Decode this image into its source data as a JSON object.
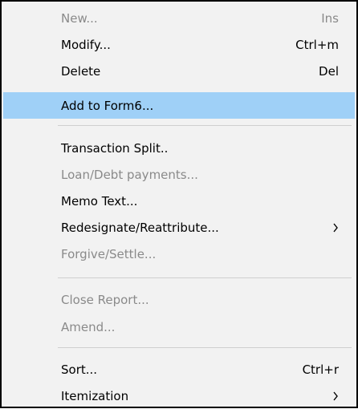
{
  "menu": {
    "items": [
      {
        "label": "New...",
        "shortcut": "Ins",
        "disabled": true
      },
      {
        "label": "Modify...",
        "shortcut": "Ctrl+m",
        "disabled": false
      },
      {
        "label": "Delete",
        "shortcut": "Del",
        "disabled": false
      },
      {
        "label": "Add to Form6...",
        "shortcut": "",
        "disabled": false,
        "highlighted": true
      },
      {
        "label": "Transaction Split..",
        "shortcut": "",
        "disabled": false
      },
      {
        "label": "Loan/Debt payments...",
        "shortcut": "",
        "disabled": true
      },
      {
        "label": "Memo Text...",
        "shortcut": "",
        "disabled": false
      },
      {
        "label": "Redesignate/Reattribute...",
        "shortcut": "",
        "disabled": false,
        "submenu": true
      },
      {
        "label": "Forgive/Settle...",
        "shortcut": "",
        "disabled": true
      },
      {
        "label": "Close Report...",
        "shortcut": "",
        "disabled": true
      },
      {
        "label": "Amend...",
        "shortcut": "",
        "disabled": true
      },
      {
        "label": "Sort...",
        "shortcut": "Ctrl+r",
        "disabled": false
      },
      {
        "label": "Itemization",
        "shortcut": "",
        "disabled": false,
        "submenu": true
      }
    ]
  },
  "colors": {
    "highlight": "#9fd0f7",
    "menu_bg": "#f2f2f2",
    "disabled_text": "#8a8a8a",
    "border": "#000000"
  },
  "icons": {
    "submenu": "chevron-right-icon"
  }
}
